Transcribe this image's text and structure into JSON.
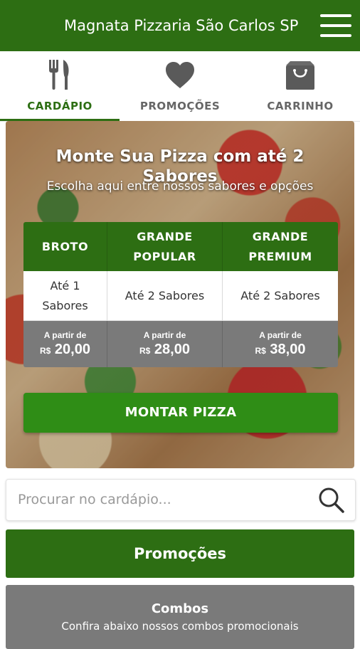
{
  "header": {
    "title": "Magnata Pizzaria São Carlos SP",
    "menu_icon": "hamburger-menu-icon"
  },
  "tabs": [
    {
      "label": "CARDÁPIO",
      "icon": "fork-knife-icon",
      "active": true
    },
    {
      "label": "PROMOÇÕES",
      "icon": "heart-icon",
      "active": false
    },
    {
      "label": "CARRINHO",
      "icon": "shopping-bag-icon",
      "active": false
    }
  ],
  "hero": {
    "title": "Monte Sua Pizza com até 2 Sabores",
    "subtitle": "Escolha aqui entre nossos sabores e opções",
    "sizes": [
      {
        "name_line1": "BROTO",
        "name_line2": "",
        "flavors": "Até 1 Sabores",
        "from_label": "A partir de",
        "currency": "R$",
        "price": "20,00"
      },
      {
        "name_line1": "GRANDE",
        "name_line2": "POPULAR",
        "flavors": "Até 2 Sabores",
        "from_label": "A partir de",
        "currency": "R$",
        "price": "28,00"
      },
      {
        "name_line1": "GRANDE",
        "name_line2": "PREMIUM",
        "flavors": "Até 2 Sabores",
        "from_label": "A partir de",
        "currency": "R$",
        "price": "38,00"
      }
    ],
    "button_label": "MONTAR PIZZA"
  },
  "search": {
    "placeholder": "Procurar no cardápio...",
    "icon": "search-icon"
  },
  "sections": {
    "promocoes_label": "Promoções",
    "combos_title": "Combos",
    "combos_subtitle": "Confira abaixo nossos combos promocionais"
  },
  "colors": {
    "brand_green": "#2d6e13",
    "button_green": "#2f8d16",
    "grey": "#7a7a7a"
  }
}
